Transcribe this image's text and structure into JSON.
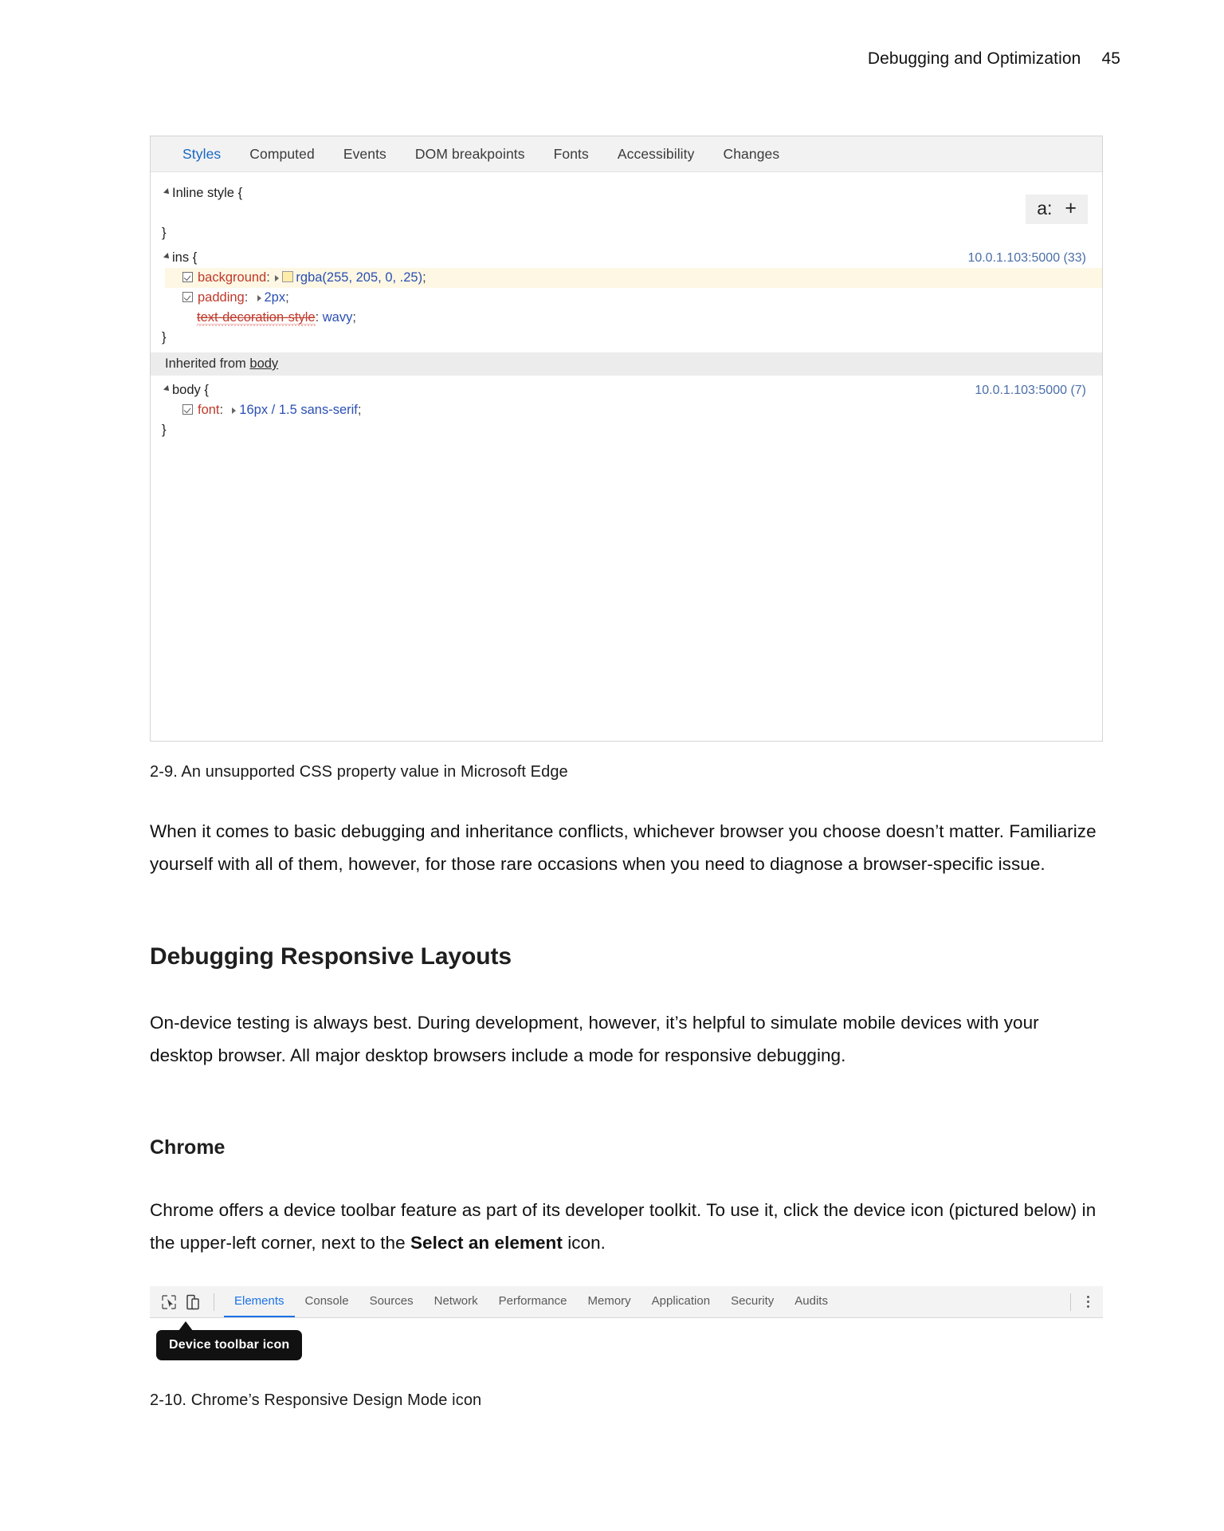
{
  "page": {
    "running_head": "Debugging and Optimization",
    "folio": "45"
  },
  "figure_edge": {
    "tabs": [
      {
        "label": "Styles",
        "active": true
      },
      {
        "label": "Computed",
        "active": false
      },
      {
        "label": "Events",
        "active": false
      },
      {
        "label": "DOM breakpoints",
        "active": false
      },
      {
        "label": "Fonts",
        "active": false
      },
      {
        "label": "Accessibility",
        "active": false
      },
      {
        "label": "Changes",
        "active": false
      }
    ],
    "toolbar": {
      "font_size_label": "a:",
      "add_rule_label": "+"
    },
    "rules": [
      {
        "selector": "Inline style",
        "open_brace": "{",
        "close_brace": "}",
        "source": "",
        "declarations": []
      },
      {
        "selector": "ins",
        "open_brace": "{",
        "close_brace": "}",
        "source": "10.0.1.103:5000 (33)",
        "declarations": [
          {
            "checkbox": true,
            "expander": true,
            "swatch": "rgba(255,205,0,.25)",
            "property": "background",
            "value": "rgba(255, 205, 0, .25)",
            "terminator": ";",
            "invalid": false
          },
          {
            "checkbox": true,
            "expander": true,
            "swatch": null,
            "property": "padding",
            "value": "2px",
            "terminator": ";",
            "invalid": false
          },
          {
            "checkbox": false,
            "expander": false,
            "swatch": null,
            "property": "text-decoration-style",
            "value": "wavy",
            "terminator": ";",
            "invalid": true
          }
        ]
      }
    ],
    "inherited_label_prefix": "Inherited from",
    "inherited_label_target": "body",
    "inherited_rule": {
      "selector": "body",
      "open_brace": "{",
      "close_brace": "}",
      "source": "10.0.1.103:5000 (7)",
      "declarations": [
        {
          "checkbox": true,
          "expander": true,
          "swatch": null,
          "property": "font",
          "value": "16px / 1.5 sans-serif",
          "terminator": ";",
          "invalid": false
        }
      ]
    }
  },
  "caption_2_9": "2-9. An unsupported CSS property value in Microsoft Edge",
  "paragraph_1": "When it comes to basic debugging and inheritance conflicts, whichever browser you choose doesn’t matter. Familiarize yourself with all of them, however, for those rare occasions when you need to diagnose a browser-specific issue.",
  "heading_responsive": "Debugging Responsive Layouts",
  "paragraph_2": "On-device testing is always best. During development, however, it’s helpful to simulate mobile devices with your desktop browser. All major desktop browsers include a mode for responsive debugging.",
  "heading_chrome": "Chrome",
  "paragraph_3": {
    "part_1": "Chrome offers a device toolbar feature as part of its developer toolkit. To use it, click the device icon (pictured below) in the upper-left corner, next to the ",
    "bold": "Select an element",
    "part_2": " icon."
  },
  "figure_chrome": {
    "icons": [
      {
        "name": "select-element-icon"
      },
      {
        "name": "device-toolbar-icon"
      }
    ],
    "tabs": [
      {
        "label": "Elements",
        "active": true
      },
      {
        "label": "Console",
        "active": false
      },
      {
        "label": "Sources",
        "active": false
      },
      {
        "label": "Network",
        "active": false
      },
      {
        "label": "Performance",
        "active": false
      },
      {
        "label": "Memory",
        "active": false
      },
      {
        "label": "Application",
        "active": false
      },
      {
        "label": "Security",
        "active": false
      },
      {
        "label": "Audits",
        "active": false
      }
    ],
    "overflow_label": "",
    "callout": "Device toolbar icon"
  },
  "caption_2_10": "2-10. Chrome’s Responsive Design Mode icon",
  "colors": {
    "link_blue": "#1667c4",
    "chrome_blue": "#1a73e8",
    "property_red": "#c0392b",
    "value_blue": "#2b4fb5",
    "source_blue": "#4b6ea8",
    "swatch": "rgba(255,205,0,.25)"
  }
}
